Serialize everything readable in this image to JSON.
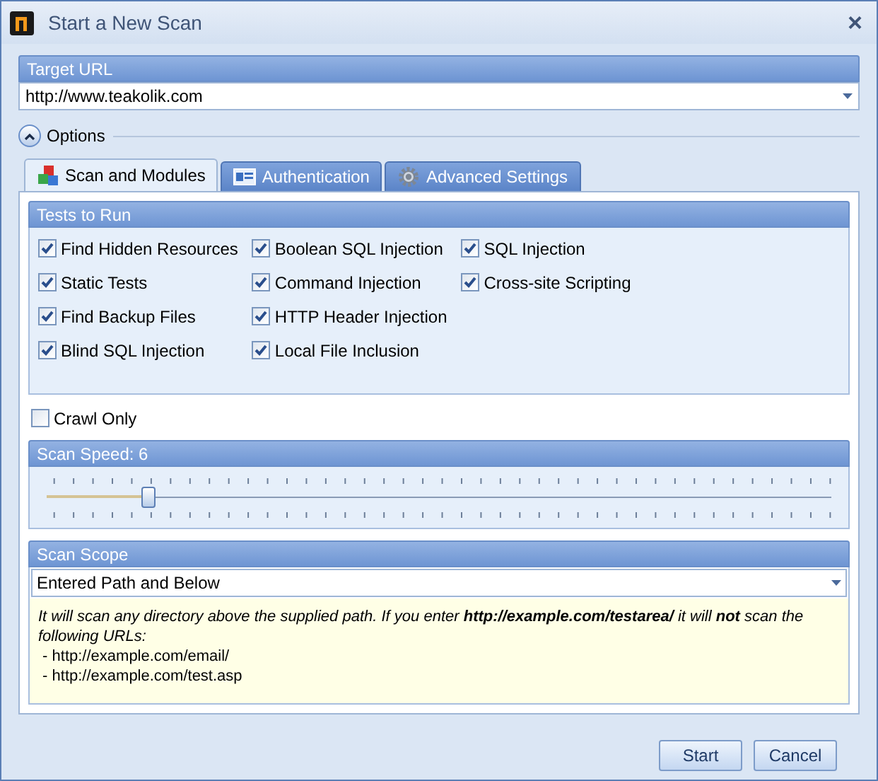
{
  "window": {
    "title": "Start a New Scan",
    "close": "×"
  },
  "target_url": {
    "header": "Target URL",
    "value": "http://www.teakolik.com"
  },
  "options": {
    "label": "Options",
    "expanded": true
  },
  "tabs": [
    {
      "label": "Scan and Modules",
      "selected": true,
      "kind": "cubes"
    },
    {
      "label": "Authentication",
      "selected": false,
      "kind": "card"
    },
    {
      "label": "Advanced Settings",
      "selected": false,
      "kind": "gear"
    }
  ],
  "tests": {
    "header": "Tests to Run",
    "columns": [
      [
        {
          "label": "Find Hidden Resources",
          "checked": true
        },
        {
          "label": "Static Tests",
          "checked": true
        },
        {
          "label": "Find Backup Files",
          "checked": true
        },
        {
          "label": "Blind SQL Injection",
          "checked": true
        }
      ],
      [
        {
          "label": "Boolean SQL Injection",
          "checked": true
        },
        {
          "label": "Command Injection",
          "checked": true
        },
        {
          "label": "HTTP Header Injection",
          "checked": true
        },
        {
          "label": "Local File Inclusion",
          "checked": true
        }
      ],
      [
        {
          "label": "SQL Injection",
          "checked": true
        },
        {
          "label": "Cross-site Scripting",
          "checked": true
        }
      ]
    ]
  },
  "crawl_only": {
    "label": "Crawl Only",
    "checked": false
  },
  "scan_speed": {
    "header": "Scan Speed: 6",
    "level": 0.13
  },
  "scan_scope": {
    "header": "Scan Scope",
    "value": "Entered Path and Below",
    "note": "It will scan any directory above the supplied path. If you enter **http://example.com/testarea/** it will **not** scan the following URLs:",
    "examples": [
      " - http://example.com/email/",
      " - http://example.com/test.asp"
    ]
  },
  "buttons": [
    "Start",
    "Cancel"
  ]
}
